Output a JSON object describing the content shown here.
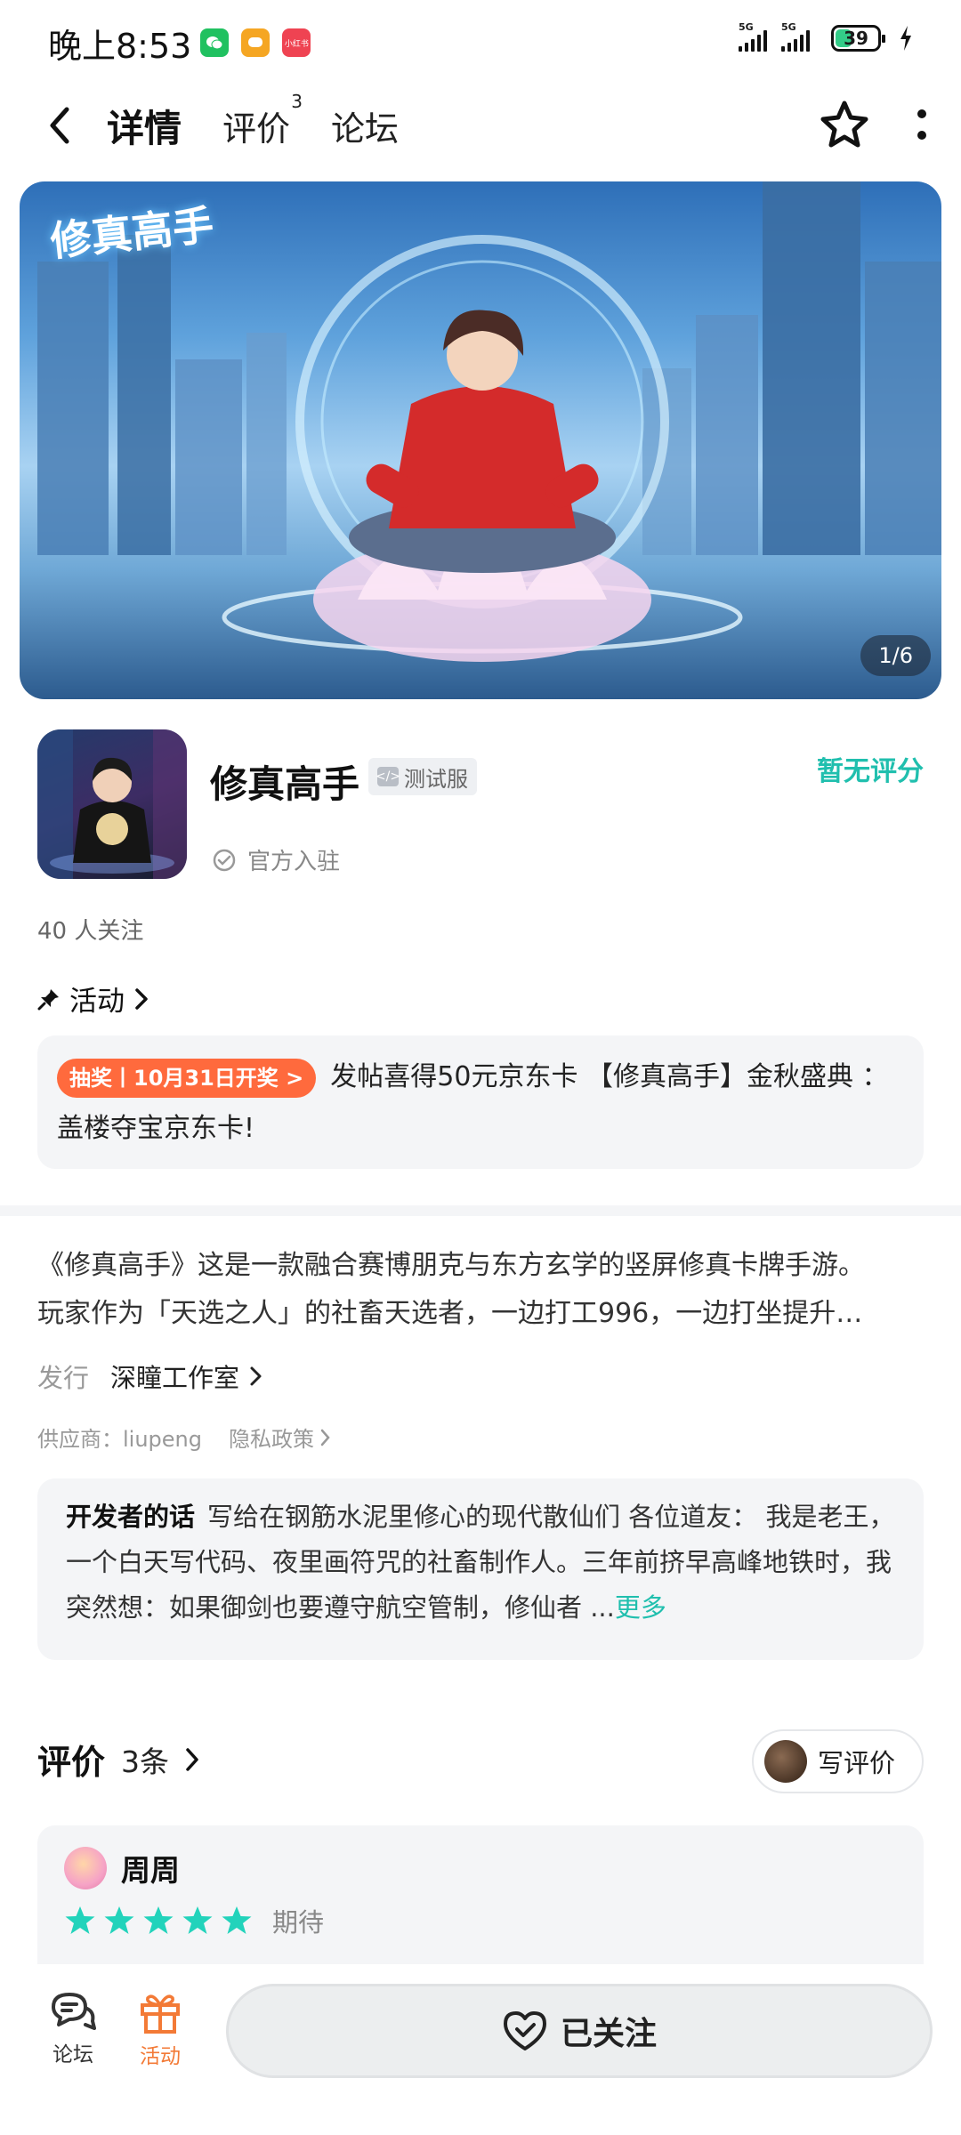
{
  "status_bar": {
    "time": "晚上8:53",
    "apps": [
      "wechat-icon",
      "chat-icon",
      "xiaohongshu-icon"
    ],
    "xiaohongshu_label": "小红书",
    "signal_label": "5G",
    "battery": "39"
  },
  "nav": {
    "tabs": [
      {
        "label": "详情",
        "active": true
      },
      {
        "label": "评价",
        "badge": "3"
      },
      {
        "label": "论坛"
      }
    ]
  },
  "banner": {
    "logo_text": "修真高手",
    "counter": "1/6"
  },
  "game": {
    "title": "修真高手",
    "test_badge": "测试服",
    "official": "官方入驻",
    "rating": "暂无评分",
    "followers": "40 人关注"
  },
  "activity": {
    "header": "活动",
    "tag": "抽奖丨10月31日开奖 >",
    "text": "发帖喜得50元京东卡 【修真高手】金秋盛典 ：盖楼夺宝京东卡!"
  },
  "description": {
    "line1": "《修真高手》这是一款融合赛博朋克与东方玄学的竖屏修真卡牌手游。",
    "line2": "玩家作为「天选之人」的社畜天选者，一边打工996，一边打坐提升…"
  },
  "publisher": {
    "label": "发行",
    "value": "深瞳工作室"
  },
  "supplier": {
    "text": "供应商：liupeng",
    "privacy": "隐私政策"
  },
  "developer_note": {
    "title": "开发者的话",
    "body": "写给在钢筋水泥里修心的现代散仙们 各位道友： 我是老王，一个白天写代码、夜里画符咒的社畜制作人。三年前挤早高峰地铁时，我突然想：如果御剑也要遵守航空管制，修仙者 ...",
    "more": "更多"
  },
  "reviews": {
    "title": "评价",
    "count": "3条",
    "write_label": "写评价",
    "items": [
      {
        "name": "周周",
        "stars": 5,
        "label": "期待"
      }
    ]
  },
  "bottom": {
    "forum_label": "论坛",
    "activity_label": "活动",
    "follow_label": "已关注"
  },
  "colors": {
    "accent": "#20bfae",
    "activity_orange": "#ff6a3d",
    "bottom_activity": "#f37a36",
    "star": "#22d3bb"
  }
}
